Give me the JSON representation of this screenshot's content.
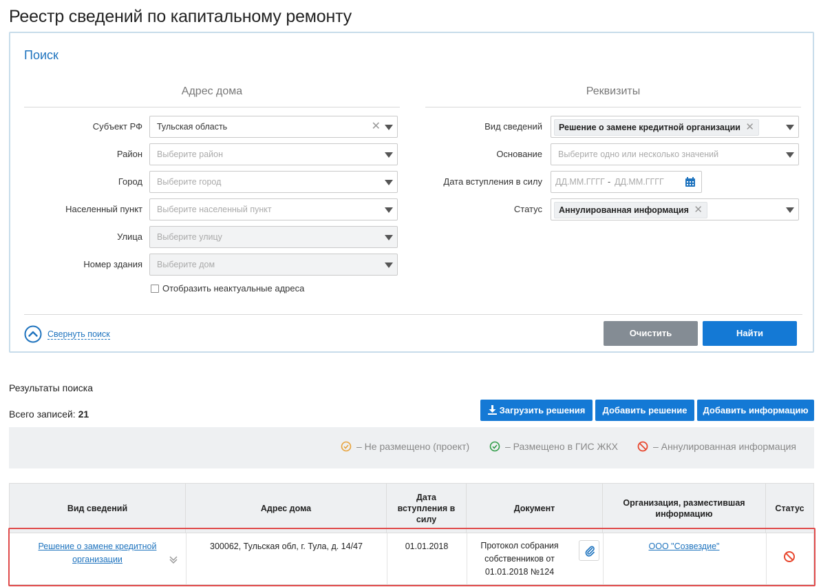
{
  "page": {
    "title": "Реестр сведений по капитальному ремонту"
  },
  "search": {
    "heading": "Поиск",
    "address_section": {
      "title": "Адрес дома",
      "fields": {
        "subject": {
          "label": "Субъект РФ",
          "value": "Тульская область"
        },
        "district": {
          "label": "Район",
          "placeholder": "Выберите район"
        },
        "city": {
          "label": "Город",
          "placeholder": "Выберите город"
        },
        "locality": {
          "label": "Населенный пункт",
          "placeholder": "Выберите населенный пункт"
        },
        "street": {
          "label": "Улица",
          "placeholder": "Выберите улицу"
        },
        "building": {
          "label": "Номер здания",
          "placeholder": "Выберите дом"
        }
      },
      "show_inactive_label": "Отобразить неактуальные адреса"
    },
    "details_section": {
      "title": "Реквизиты",
      "fields": {
        "info_type": {
          "label": "Вид сведений",
          "tag": "Решение о замене кредитной организации"
        },
        "basis": {
          "label": "Основание",
          "placeholder": "Выберите одно или несколько значений"
        },
        "effective_date": {
          "label": "Дата вступления в силу",
          "from_placeholder": "ДД.ММ.ГГГГ",
          "separator": "-",
          "to_placeholder": "ДД.ММ.ГГГГ"
        },
        "status": {
          "label": "Статус",
          "tag": "Аннулированная информация"
        }
      }
    },
    "collapse_label": "Свернуть поиск",
    "clear_button": "Очистить",
    "find_button": "Найти"
  },
  "results": {
    "title": "Результаты поиска",
    "total_label": "Всего записей:",
    "total_value": "21",
    "actions": {
      "upload": "Загрузить решения",
      "add_decision": "Добавить решение",
      "add_info": "Добавить информацию"
    },
    "legend": {
      "draft": "–  Не размещено (проект)",
      "posted": "–  Размещено в ГИС ЖКХ",
      "annulled": "–  Аннулированная информация"
    },
    "colors": {
      "draft": "#e8a23a",
      "posted": "#2e9c46",
      "annulled": "#e8472e",
      "accent": "#1479d5"
    },
    "table": {
      "headers": {
        "type": "Вид сведений",
        "address": "Адрес дома",
        "date": "Дата вступления в силу",
        "document": "Документ",
        "org": "Организация, разместившая информацию",
        "status": "Статус"
      },
      "rows": [
        {
          "type": "Решение о замене кредитной организации",
          "address": "300062, Тульская обл, г. Тула, д. 14/47",
          "date": "01.01.2018",
          "document": "Протокол собрания собственников от 01.01.2018 №124",
          "org": "ООО \"Созвездие\"",
          "status_icon": "annulled-icon"
        }
      ]
    }
  }
}
